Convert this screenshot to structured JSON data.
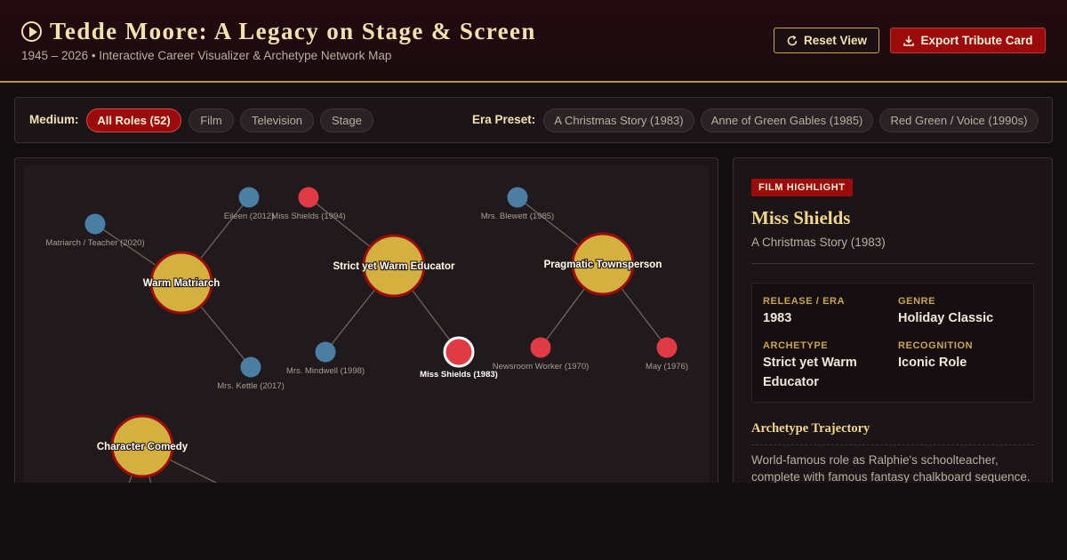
{
  "header": {
    "title": "Tedde Moore: A Legacy on Stage & Screen",
    "subtitle": "1945 – 2026 • Interactive Career Visualizer & Archetype Network Map",
    "reset_label": "Reset View",
    "export_label": "Export Tribute Card"
  },
  "filters": {
    "medium_label": "Medium:",
    "medium_options": [
      "All Roles (52)",
      "Film",
      "Television",
      "Stage"
    ],
    "medium_selected": "All Roles (52)",
    "era_label": "Era Preset:",
    "era_options": [
      "A Christmas Story (1983)",
      "Anne of Green Gables (1985)",
      "Red Green / Voice (1990s)"
    ]
  },
  "network": {
    "archetypes": [
      {
        "label": "Warm Matriarch"
      },
      {
        "label": "Strict yet Warm Educator"
      },
      {
        "label": "Pragmatic Townsperson"
      },
      {
        "label": "Character Comedy"
      }
    ],
    "roles": [
      {
        "label": "Matriarch / Teacher (2020)",
        "medium": "tv"
      },
      {
        "label": "Eileen (2012)",
        "medium": "tv"
      },
      {
        "label": "Miss Shields (1994)",
        "medium": "film"
      },
      {
        "label": "Mrs. Blewett (1985)",
        "medium": "tv"
      },
      {
        "label": "Mrs. Kettle (2017)",
        "medium": "tv"
      },
      {
        "label": "Mrs. Mindwell (1998)",
        "medium": "tv"
      },
      {
        "label": "Miss Shields (1983)",
        "medium": "film",
        "selected": true
      },
      {
        "label": "Newsroom Worker (1970)",
        "medium": "film"
      },
      {
        "label": "May (1976)",
        "medium": "film"
      }
    ],
    "colors": {
      "archetype_fill": "#d4b13f",
      "archetype_stroke": "#9c0b0b",
      "film": "#e03b45",
      "tv": "#4a7fa3",
      "edge": "#6e6563"
    }
  },
  "detail": {
    "badge": "FILM HIGHLIGHT",
    "title": "Miss Shields",
    "film": "A Christmas Story (1983)",
    "release_label": "RELEASE / ERA",
    "release_value": "1983",
    "genre_label": "GENRE",
    "genre_value": "Holiday Classic",
    "archetype_label": "ARCHETYPE",
    "archetype_value": "Strict yet Warm Educator",
    "recognition_label": "RECOGNITION",
    "recognition_value": "Iconic Role",
    "trajectory_title": "Archetype Trajectory",
    "trajectory_text": "World-famous role as Ralphie's schoolteacher, complete with famous fantasy chalkboard sequence."
  }
}
